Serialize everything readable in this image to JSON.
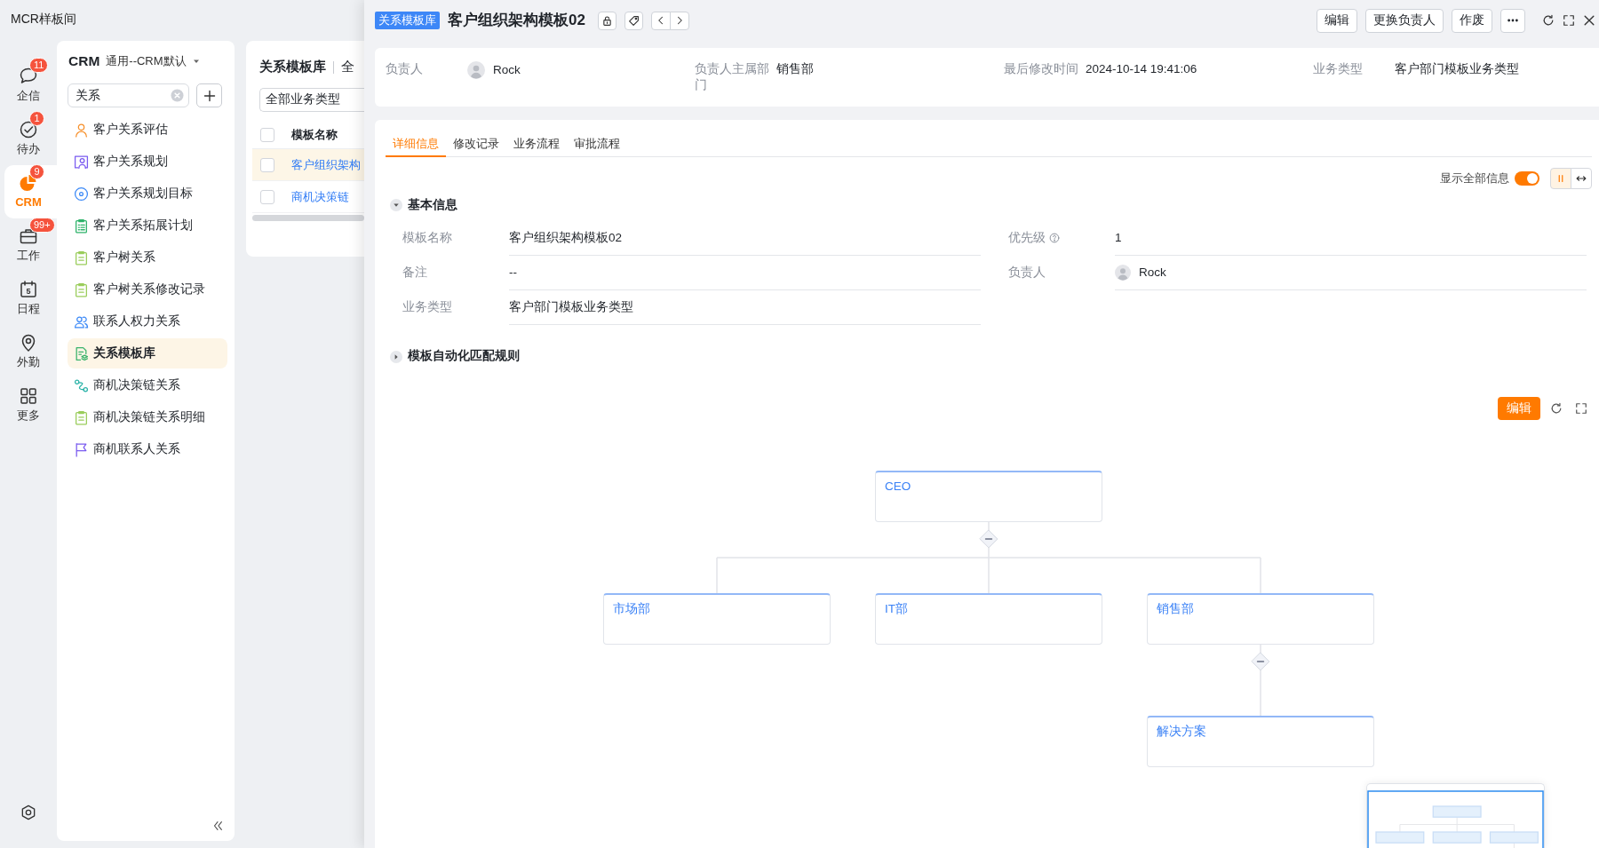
{
  "app": {
    "title": "MCR样板间"
  },
  "rail": {
    "items": [
      {
        "label": "企信",
        "badge": "11",
        "selected": false
      },
      {
        "label": "待办",
        "badge": "1",
        "selected": false
      },
      {
        "label": "CRM",
        "badge": "9",
        "selected": true
      },
      {
        "label": "工作",
        "badge": "99+",
        "selected": false
      },
      {
        "label": "日程",
        "date": "5",
        "selected": false
      },
      {
        "label": "外勤",
        "selected": false
      },
      {
        "label": "更多",
        "selected": false
      }
    ]
  },
  "nav": {
    "title": "CRM",
    "scope": "通用--CRM默认",
    "search": {
      "value": "关系"
    },
    "items": [
      {
        "label": "客户关系评估",
        "selected": false
      },
      {
        "label": "客户关系规划",
        "selected": false
      },
      {
        "label": "客户关系规划目标",
        "selected": false
      },
      {
        "label": "客户关系拓展计划",
        "selected": false
      },
      {
        "label": "客户树关系",
        "selected": false
      },
      {
        "label": "客户树关系修改记录",
        "selected": false
      },
      {
        "label": "联系人权力关系",
        "selected": false
      },
      {
        "label": "关系模板库",
        "selected": true
      },
      {
        "label": "商机决策链关系",
        "selected": false
      },
      {
        "label": "商机决策链关系明细",
        "selected": false
      },
      {
        "label": "商机联系人关系",
        "selected": false
      }
    ]
  },
  "list": {
    "title": "关系模板库",
    "scope": "全",
    "type_select": {
      "value": "全部业务类型"
    },
    "select_all": {
      "checked": false
    },
    "columns": [
      "模板名称"
    ],
    "rows": [
      {
        "name": "客户组织架构",
        "selected": true,
        "checked": false
      },
      {
        "name": "商机决策链",
        "selected": false,
        "checked": false
      }
    ]
  },
  "detail": {
    "badge": "关系模板库",
    "title": "客户组织架构模板02",
    "actions": [
      "编辑",
      "更换负责人",
      "作废"
    ],
    "summary": [
      {
        "label": "负责人",
        "value": "Rock",
        "kind": "person"
      },
      {
        "label": "负责人主属部门",
        "value": "销售部",
        "kind": "text"
      },
      {
        "label": "最后修改时间",
        "value": "2024-10-14 19:41:06",
        "kind": "text"
      },
      {
        "label": "业务类型",
        "value": "客户部门模板业务类型",
        "kind": "text"
      }
    ],
    "tabs": [
      {
        "label": "详细信息",
        "selected": true
      },
      {
        "label": "修改记录",
        "selected": false
      },
      {
        "label": "业务流程",
        "selected": false
      },
      {
        "label": "审批流程",
        "selected": false
      }
    ],
    "show_all": {
      "label": "显示全部信息",
      "on": true
    },
    "view_modes": [
      {
        "selected": true
      },
      {
        "selected": false
      }
    ],
    "sections": [
      {
        "title": "基本信息",
        "expanded": true,
        "fields": [
          {
            "label": "模板名称",
            "value": "客户组织架构模板02",
            "kind": "text"
          },
          {
            "label": "优先级",
            "value": "1",
            "kind": "text",
            "help": true
          },
          {
            "label": "备注",
            "value": "--",
            "kind": "text"
          },
          {
            "label": "负责人",
            "value": "Rock",
            "kind": "person"
          },
          {
            "label": "业务类型",
            "value": "客户部门模板业务类型",
            "kind": "text"
          }
        ]
      },
      {
        "title": "模板自动化匹配规则",
        "expanded": false
      }
    ]
  },
  "org_chart": {
    "edit_button": "编辑",
    "nodes": [
      {
        "label": "CEO",
        "expanded": true,
        "children": [
          {
            "label": "市场部"
          },
          {
            "label": "IT部"
          },
          {
            "label": "销售部",
            "expanded": true,
            "children": [
              {
                "label": "解决方案"
              }
            ]
          }
        ]
      }
    ]
  }
}
